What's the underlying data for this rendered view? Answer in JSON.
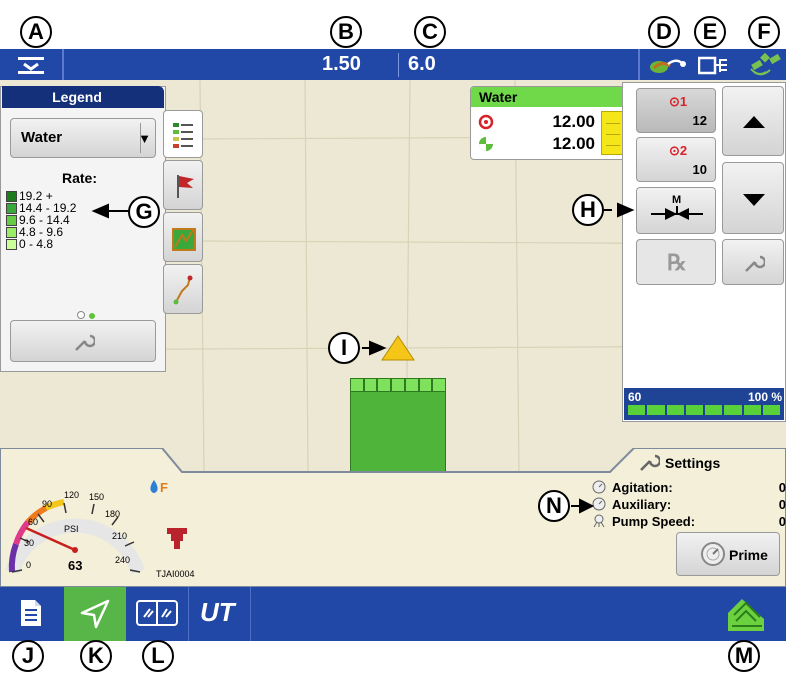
{
  "callouts": {
    "a": "A",
    "b": "B",
    "c": "C",
    "d": "D",
    "e": "E",
    "f": "F",
    "g": "G",
    "h": "H",
    "i": "I",
    "j": "J",
    "k": "K",
    "l": "L",
    "m": "M",
    "n": "N"
  },
  "topbar": {
    "value_b": "1.50",
    "value_c": "6.0",
    "bg_color": "#2147a7"
  },
  "legend": {
    "title": "Legend",
    "product": "Water",
    "rate_label": "Rate:",
    "items": [
      {
        "label": "19.2 +",
        "color": "#1e7b1e"
      },
      {
        "label": "14.4 - 19.2",
        "color": "#3aa83a"
      },
      {
        "label": "9.6 - 14.4",
        "color": "#66cc44"
      },
      {
        "label": "4.8 - 9.6",
        "color": "#99ee66"
      },
      {
        "label": "0 - 4.8",
        "color": "#ccff99"
      }
    ]
  },
  "product_panel": {
    "name": "Water",
    "target_rate": "12.00",
    "actual_rate": "12.00"
  },
  "rate_buttons": {
    "preset1_index": "1",
    "preset1_value": "12",
    "preset2_index": "2",
    "preset2_value": "10",
    "manual_label": "M",
    "rx_label": "℞"
  },
  "boom_bar": {
    "left_value": "60",
    "right_value": "100 %",
    "sections": 8
  },
  "settings": {
    "title": "Settings",
    "agitation_label": "Agitation:",
    "agitation_value": "0",
    "auxiliary_label": "Auxiliary:",
    "auxiliary_value": "0",
    "pump_speed_label": "Pump Speed:",
    "pump_speed_value": "0",
    "prime_label": "Prime"
  },
  "gauge": {
    "unit": "PSI",
    "value": "63",
    "ticks": [
      "0",
      "30",
      "60",
      "90",
      "120",
      "150",
      "180",
      "210",
      "240"
    ],
    "nozzle": "TJAI0004"
  },
  "bottombar": {
    "ut_label": "UT",
    "bg_color": "#2147a7",
    "active_tab_color": "#58b548"
  }
}
